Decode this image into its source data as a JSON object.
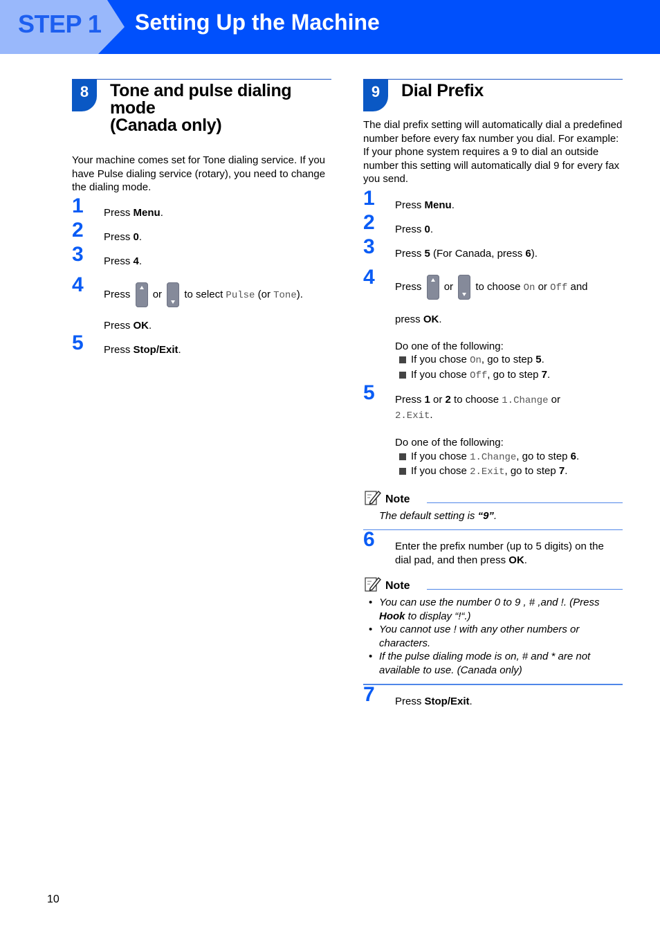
{
  "banner": {
    "step_label": "STEP 1",
    "title": "Setting Up the Machine",
    "colors": {
      "main": "#0050fc",
      "chevron": "#99b8fb",
      "step_text": "#1d5ff0"
    }
  },
  "sections": [
    {
      "number": "8",
      "title_line1": "Tone and pulse dialing mode",
      "title_line2": "(Canada only)",
      "intro": "Your machine comes set for Tone dialing service. If you have Pulse dialing service (rotary), you need to change the dialing mode.",
      "steps": [
        {
          "num": "1",
          "pre": "Press ",
          "bold": "Menu",
          "post": "."
        },
        {
          "num": "2",
          "pre": "Press ",
          "bold": "0",
          "post": "."
        },
        {
          "num": "3",
          "pre": "Press ",
          "bold": "4",
          "post": "."
        },
        {
          "num": "4",
          "pre": "Press",
          "or": "or",
          "mid": "to select",
          "opt1": "Pulse",
          "paren_open": "(or",
          "opt2": "Tone",
          "paren_close": ").",
          "line2_pre": "Press ",
          "line2_bold": "OK",
          "line2_post": "."
        },
        {
          "num": "5",
          "pre": "Press ",
          "bold": "Stop/Exit",
          "post": "."
        }
      ]
    },
    {
      "number": "9",
      "title": "Dial Prefix",
      "intro": "The dial prefix setting will automatically dial a predefined number before every fax number you dial. For example: If your phone system requires a 9 to dial an outside number this setting will automatically dial 9 for every fax you send.",
      "steps": [
        {
          "num": "1",
          "pre": "Press ",
          "bold": "Menu",
          "post": "."
        },
        {
          "num": "2",
          "pre": "Press ",
          "bold": "0",
          "post": "."
        },
        {
          "num": "3",
          "pre": "Press ",
          "bold": "5",
          "mid": " (For Canada, press ",
          "bold2": "6",
          "post": ")."
        },
        {
          "num": "4",
          "pre": "Press",
          "or": "or",
          "mid": "to choose",
          "opt1": "On",
          "or2": "or",
          "opt2": "Off",
          "end": "and",
          "line2_pre": "press ",
          "line2_bold": "OK",
          "line2_post": ".",
          "choice_intro": "Do one of the following:",
          "choices": [
            {
              "pre": "If you chose ",
              "mono": "On",
              "mid": ", go to step ",
              "bold": "5",
              "post": "."
            },
            {
              "pre": "If you chose ",
              "mono": "Off",
              "mid": ", go to step ",
              "bold": "7",
              "post": "."
            }
          ]
        },
        {
          "num": "5",
          "pre": "Press ",
          "bold1": "1",
          "or": " or ",
          "bold2": "2",
          "mid": " to choose ",
          "opt1": "1.Change",
          "or2": " or",
          "opt2": "2.Exit",
          "post": ".",
          "choice_intro": "Do one of the following:",
          "choices": [
            {
              "pre": "If you chose ",
              "mono": "1.Change",
              "mid": ", go to step ",
              "bold": "6",
              "post": "."
            },
            {
              "pre": "If you chose ",
              "mono": "2.Exit",
              "mid": ", go to step ",
              "bold": "7",
              "post": "."
            }
          ]
        },
        {
          "num": "6",
          "pre": "Enter the prefix number (up to 5 digits) on the dial pad, and then press ",
          "bold": "OK",
          "post": "."
        },
        {
          "num": "7",
          "pre": "Press ",
          "bold": "Stop/Exit",
          "post": "."
        }
      ],
      "note1": {
        "label": "Note",
        "pre": "The default setting is ",
        "bold": "“9”",
        "post": "."
      },
      "note2": {
        "label": "Note",
        "items": [
          {
            "pre": "You can use the number 0 to 9 , # ,and !. (Press ",
            "bold": "Hook",
            "post": " to display “!“.)"
          },
          {
            "text": "You cannot use ! with any other numbers or characters."
          },
          {
            "text": "If the pulse dialing mode is on, # and * are not available to use. (Canada only)"
          }
        ]
      }
    }
  ],
  "page_number": "10"
}
